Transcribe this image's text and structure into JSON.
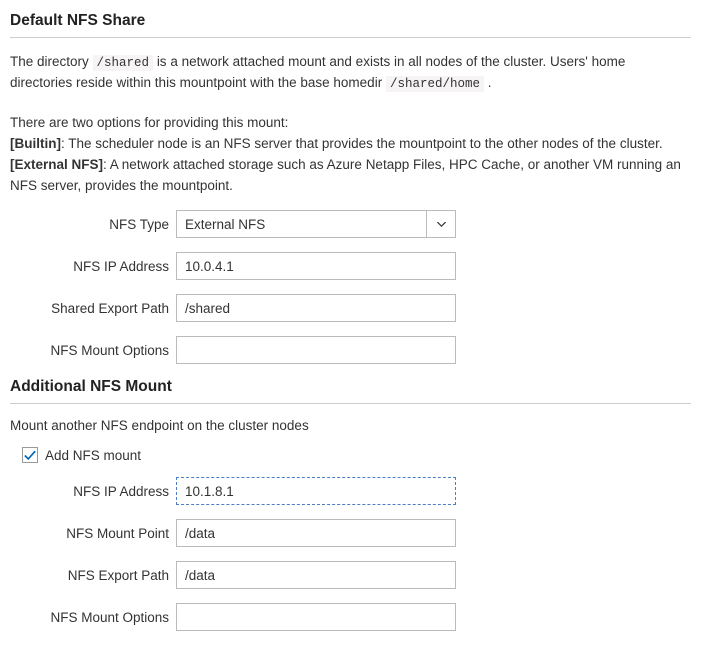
{
  "section1": {
    "heading": "Default NFS Share",
    "desc_part1": "The directory ",
    "desc_code1": "/shared",
    "desc_part2": " is a network attached mount and exists in all nodes of the cluster. Users' home directories reside within this mountpoint with the base homedir ",
    "desc_code2": "/shared/home",
    "desc_part3": " .",
    "options_intro": "There are two options for providing this mount:",
    "builtin_label": "[Builtin]",
    "builtin_text": ": The scheduler node is an NFS server that provides the mountpoint to the other nodes of the cluster.",
    "external_label": "[External NFS]",
    "external_text": ": A network attached storage such as Azure Netapp Files, HPC Cache, or another VM running an NFS server, provides the mountpoint.",
    "fields": {
      "nfs_type": {
        "label": "NFS Type",
        "value": "External NFS"
      },
      "nfs_ip": {
        "label": "NFS IP Address",
        "value": "10.0.4.1"
      },
      "export_path": {
        "label": "Shared Export Path",
        "value": "/shared"
      },
      "mount_options": {
        "label": "NFS Mount Options",
        "value": ""
      }
    }
  },
  "section2": {
    "heading": "Additional NFS Mount",
    "desc": "Mount another NFS endpoint on the cluster nodes",
    "checkbox_label": "Add NFS mount",
    "checkbox_checked": true,
    "fields": {
      "nfs_ip": {
        "label": "NFS IP Address",
        "value": "10.1.8.1"
      },
      "mount_point": {
        "label": "NFS Mount Point",
        "value": "/data"
      },
      "export_path": {
        "label": "NFS Export Path",
        "value": "/data"
      },
      "mount_options": {
        "label": "NFS Mount Options",
        "value": ""
      }
    }
  }
}
